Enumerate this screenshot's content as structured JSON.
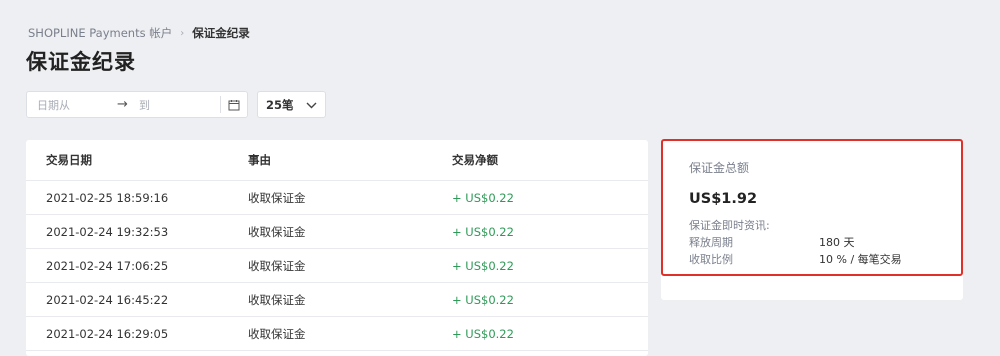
{
  "breadcrumb": {
    "parent": "SHOPLINE Payments 帐户",
    "current": "保证金纪录"
  },
  "page_title": "保证金纪录",
  "filters": {
    "date_from_placeholder": "日期从",
    "date_to_placeholder": "到",
    "page_size": "25笔"
  },
  "table": {
    "headers": {
      "date": "交易日期",
      "reason": "事由",
      "amount": "交易净额"
    },
    "rows": [
      {
        "date": "2021-02-25 18:59:16",
        "reason": "收取保证金",
        "amount": "+ US$0.22"
      },
      {
        "date": "2021-02-24 19:32:53",
        "reason": "收取保证金",
        "amount": "+ US$0.22"
      },
      {
        "date": "2021-02-24 17:06:25",
        "reason": "收取保证金",
        "amount": "+ US$0.22"
      },
      {
        "date": "2021-02-24 16:45:22",
        "reason": "收取保证金",
        "amount": "+ US$0.22"
      },
      {
        "date": "2021-02-24 16:29:05",
        "reason": "收取保证金",
        "amount": "+ US$0.22"
      }
    ]
  },
  "summary": {
    "label": "保证金总额",
    "total": "US$1.92",
    "info_title": "保证金即时资讯:",
    "release_period_label": "释放周期",
    "release_period_value": "180 天",
    "rate_label": "收取比例",
    "rate_value": "10 % / 每笔交易"
  },
  "colors": {
    "positive_amount": "#2e9a57",
    "highlight_border": "#e0302a",
    "background": "#eeeff2"
  }
}
